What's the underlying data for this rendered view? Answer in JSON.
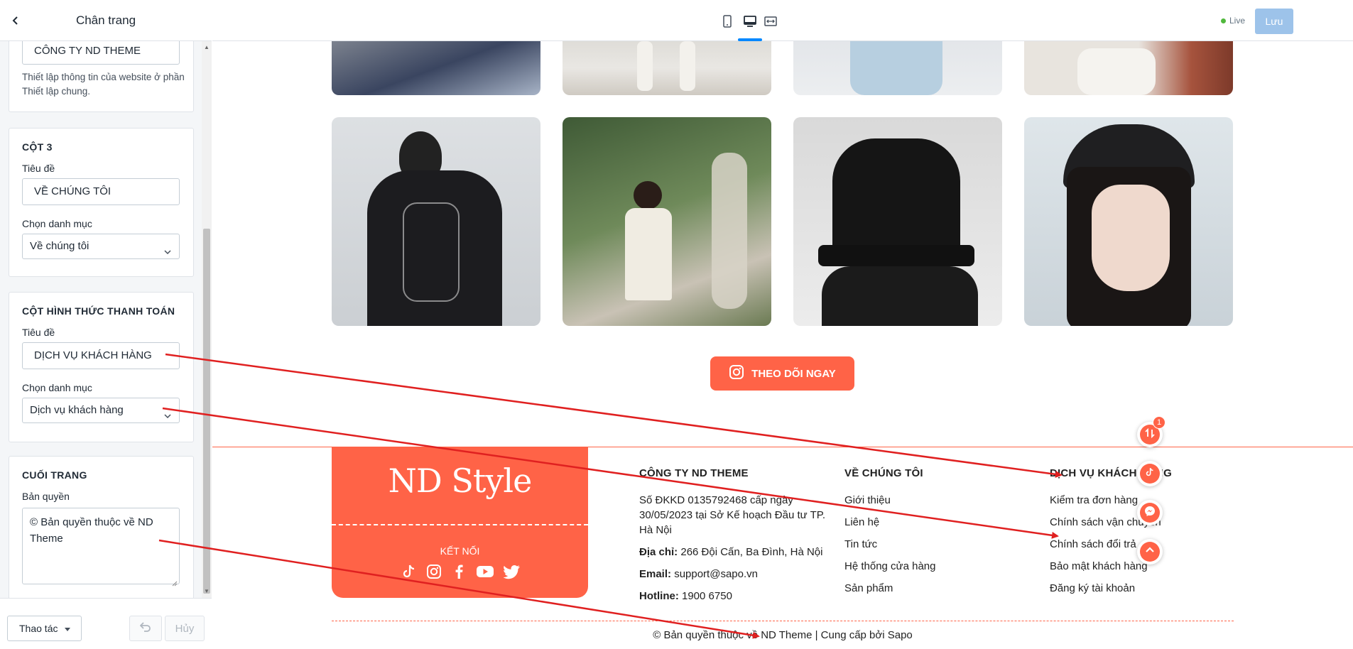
{
  "sidebar": {
    "title": "Chân trang",
    "column2": {
      "title_value": "CÔNG TY ND THEME",
      "help": "Thiết lập thông tin của website ở phần Thiết lập chung."
    },
    "column3": {
      "heading": "CỘT 3",
      "title_label": "Tiêu đề",
      "title_value": "VỀ CHÚNG TÔI",
      "category_label": "Chọn danh mục",
      "category_value": "Về chúng tôi"
    },
    "payment_column": {
      "heading": "CỘT HÌNH THỨC THANH TOÁN",
      "title_label": "Tiêu đề",
      "title_value": "DỊCH VỤ KHÁCH HÀNG",
      "category_label": "Chọn danh mục",
      "category_value": "Dịch vụ khách hàng"
    },
    "bottom": {
      "heading": "CUỐI TRANG",
      "copyright_label": "Bản quyền",
      "copyright_value": "© Bản quyền thuộc về ND Theme"
    },
    "footer": {
      "actions_label": "Thao tác",
      "cancel_label": "Hủy"
    }
  },
  "topbar": {
    "live_label": "Live",
    "save_label": "Lưu",
    "devices": [
      "mobile-icon",
      "desktop-icon",
      "fullwidth-icon"
    ],
    "active_device": "desktop"
  },
  "preview": {
    "follow_button": "THEO DÕI NGAY",
    "brand": {
      "logo": "ND Style",
      "connect": "KẾT NỐI",
      "socials": [
        "tiktok-icon",
        "instagram-icon",
        "facebook-icon",
        "youtube-icon",
        "twitter-icon"
      ]
    },
    "company": {
      "title": "CÔNG TY ND THEME",
      "registration": "Số ĐKKD 0135792468 cấp ngày 30/05/2023 tại Sở Kế hoạch Đầu tư TP. Hà Nội",
      "address_label": "Địa chỉ:",
      "address": "266 Đội Cấn, Ba Đình, Hà Nội",
      "email_label": "Email:",
      "email": "support@sapo.vn",
      "hotline_label": "Hotline:",
      "hotline": "1900 6750"
    },
    "about": {
      "title": "VỀ CHÚNG TÔI",
      "links": [
        "Giới thiệu",
        "Liên hệ",
        "Tin tức",
        "Hệ thống cửa hàng",
        "Sản phẩm"
      ]
    },
    "service": {
      "title": "DỊCH VỤ KHÁCH HÀNG",
      "links": [
        "Kiểm tra đơn hàng",
        "Chính sách vận chuyển",
        "Chính sách đổi trả",
        "Bảo mật khách hàng",
        "Đăng ký tài khoản"
      ]
    },
    "copyright": "© Bản quyền thuộc về ND Theme | Cung cấp bởi Sapo",
    "fab_badge": "1"
  },
  "colors": {
    "accent": "#ff6347",
    "annotation_arrow": "#e02020",
    "save_button": "#9dc3ea",
    "live_dot": "#50b83c"
  }
}
